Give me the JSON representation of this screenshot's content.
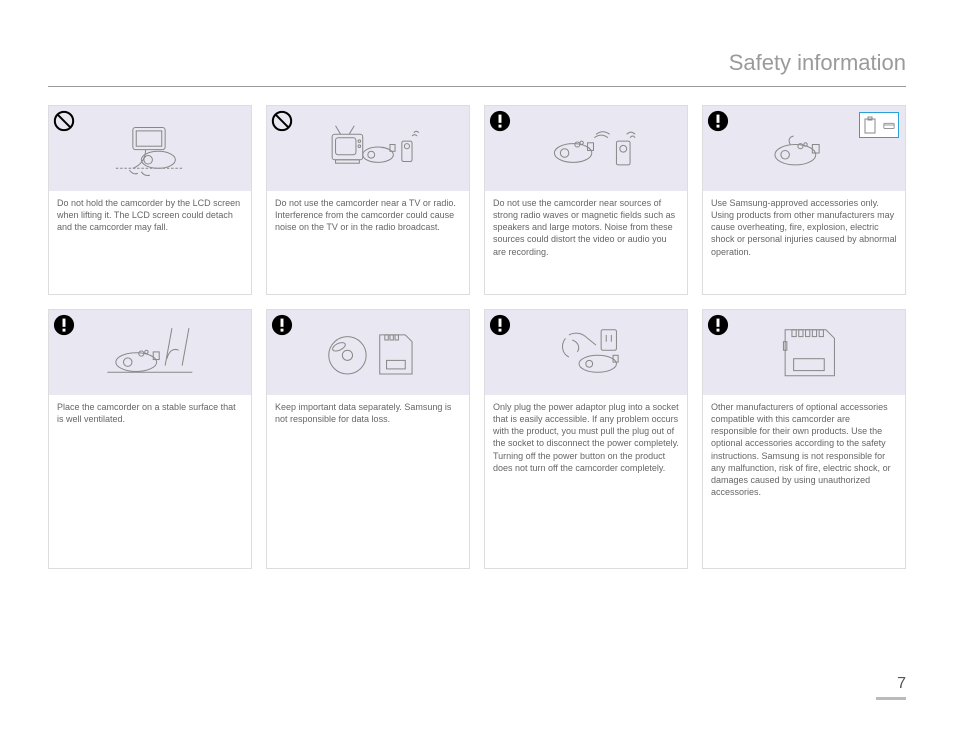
{
  "page_title": "Safety information",
  "page_number": "7",
  "icons": {
    "prohibit": "prohibit-icon",
    "caution": "caution-icon"
  },
  "cards": [
    {
      "type": "prohibit",
      "text": "Do not hold the camcorder by the LCD screen when lifting it. The LCD screen could detach and the camcorder may fall."
    },
    {
      "type": "prohibit",
      "text": "Do not use the camcorder near a TV or radio. Interference from the camcorder could cause noise on the TV or in the radio broadcast."
    },
    {
      "type": "caution",
      "text": "Do not use the camcorder near sources of strong radio waves or magnetic fields such as speakers and large motors. Noise from these sources could distort the video or audio you are recording."
    },
    {
      "type": "caution",
      "text": "Use Samsung-approved accessories only. Using products from other manufacturers may cause overheating, fire, explosion, electric shock or personal injuries caused by abnormal operation."
    },
    {
      "type": "caution",
      "text": "Place the camcorder on a stable surface that is well ventilated."
    },
    {
      "type": "caution",
      "text": "Keep important data separately. Samsung is not responsible for data loss."
    },
    {
      "type": "caution",
      "text": "Only plug the power adaptor plug into a socket that is easily accessible. If any problem occurs with the product, you must pull the plug out of the socket to disconnect the power completely. Turning off the power button on the product does not turn off the camcorder completely."
    },
    {
      "type": "caution",
      "text": "Other manufacturers of optional accessories compatible with this camcorder are responsible for their own products. Use the optional accessories according to the safety instructions. Samsung is not responsible for any malfunction, risk of fire, electric shock, or damages caused by using unauthorized accessories."
    }
  ]
}
